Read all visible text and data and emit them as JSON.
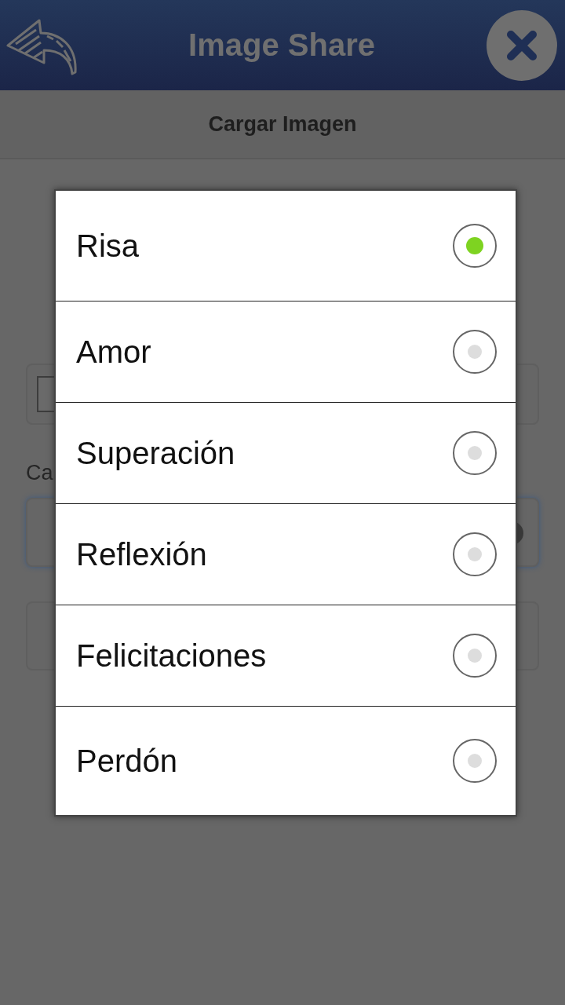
{
  "header": {
    "title": "Image Share"
  },
  "subheader": {
    "title": "Cargar Imagen"
  },
  "form": {
    "label": "Ca"
  },
  "dialog": {
    "options": [
      {
        "label": "Risa",
        "selected": true
      },
      {
        "label": "Amor",
        "selected": false
      },
      {
        "label": "Superación",
        "selected": false
      },
      {
        "label": "Reflexión",
        "selected": false
      },
      {
        "label": "Felicitaciones",
        "selected": false
      },
      {
        "label": "Perdón",
        "selected": false
      }
    ]
  }
}
